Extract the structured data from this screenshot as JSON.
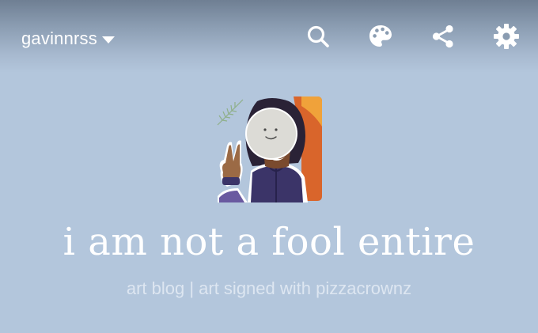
{
  "header": {
    "blog_name": "gavinnrss",
    "icons": {
      "search": "search-icon",
      "palette": "palette-icon",
      "share": "share-icon",
      "settings": "gear-icon",
      "dropdown": "caret-down-icon"
    }
  },
  "blog": {
    "title": "i am not a fool entire",
    "description": "art blog | art signed with pizzacrownz"
  },
  "colors": {
    "background": "#b3c6dc",
    "text": "#ffffff",
    "description_text": "#dde6f1"
  }
}
